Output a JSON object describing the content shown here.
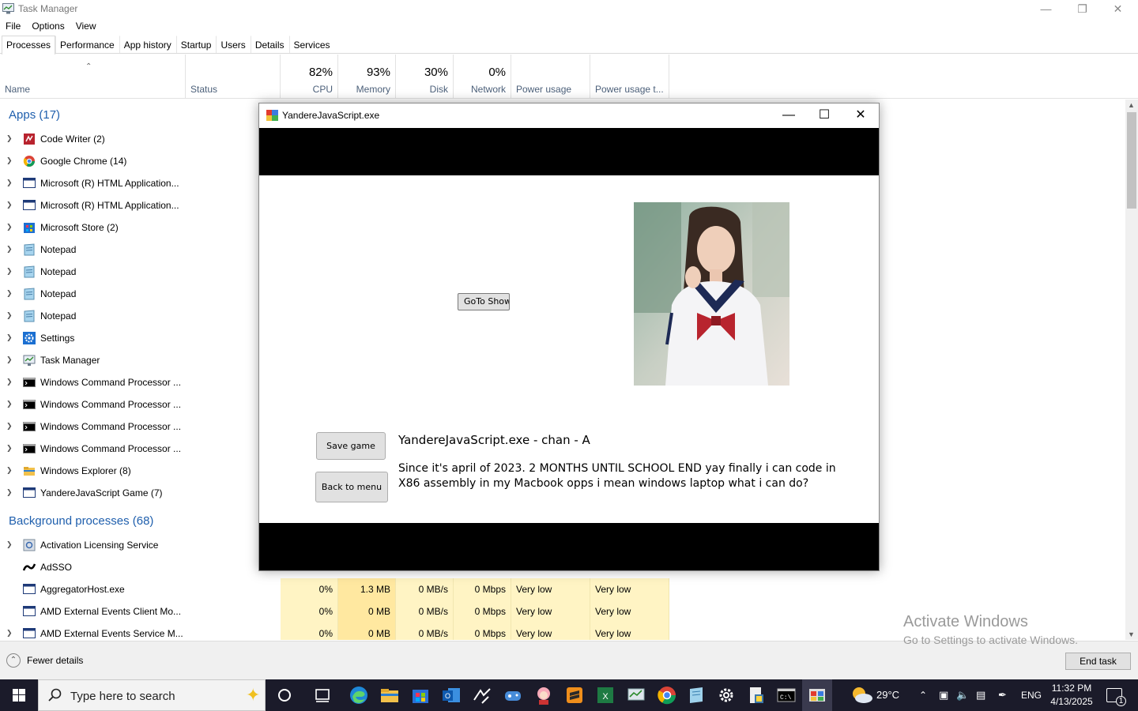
{
  "taskmanager": {
    "title": "Task Manager",
    "menu": [
      "File",
      "Options",
      "View"
    ],
    "tabs": [
      "Processes",
      "Performance",
      "App history",
      "Startup",
      "Users",
      "Details",
      "Services"
    ],
    "active_tab": "Processes",
    "columns": {
      "name": "Name",
      "status": "Status",
      "cpu": {
        "pct": "82%",
        "label": "CPU"
      },
      "memory": {
        "pct": "93%",
        "label": "Memory"
      },
      "disk": {
        "pct": "30%",
        "label": "Disk"
      },
      "network": {
        "pct": "0%",
        "label": "Network"
      },
      "power": "Power usage",
      "power_trend": "Power usage t..."
    },
    "apps_header": "Apps (17)",
    "apps": [
      {
        "name": "Code Writer (2)",
        "icon": "code-writer-icon"
      },
      {
        "name": "Google Chrome (14)",
        "icon": "chrome-icon"
      },
      {
        "name": "Microsoft (R) HTML Application...",
        "icon": "window-icon"
      },
      {
        "name": "Microsoft (R) HTML Application...",
        "icon": "window-icon"
      },
      {
        "name": "Microsoft Store (2)",
        "icon": "store-icon"
      },
      {
        "name": "Notepad",
        "icon": "notepad-icon"
      },
      {
        "name": "Notepad",
        "icon": "notepad-icon"
      },
      {
        "name": "Notepad",
        "icon": "notepad-icon"
      },
      {
        "name": "Notepad",
        "icon": "notepad-icon"
      },
      {
        "name": "Settings",
        "icon": "gear-icon"
      },
      {
        "name": "Task Manager",
        "icon": "task-manager-icon"
      },
      {
        "name": "Windows Command Processor ...",
        "icon": "cmd-icon"
      },
      {
        "name": "Windows Command Processor ...",
        "icon": "cmd-icon"
      },
      {
        "name": "Windows Command Processor ...",
        "icon": "cmd-icon"
      },
      {
        "name": "Windows Command Processor ...",
        "icon": "cmd-icon"
      },
      {
        "name": "Windows Explorer (8)",
        "icon": "folder-icon"
      },
      {
        "name": "YandereJavaScript Game (7)",
        "icon": "window-icon"
      }
    ],
    "bg_header": "Background processes (68)",
    "bg": [
      {
        "name": "Activation Licensing Service",
        "expand": true,
        "icon": "service-icon",
        "values": null
      },
      {
        "name": "AdSSO",
        "expand": false,
        "icon": "adsso-icon",
        "values": null
      },
      {
        "name": "AggregatorHost.exe",
        "expand": false,
        "icon": "window-icon",
        "values": {
          "cpu": "0%",
          "mem": "1.3 MB",
          "disk": "0 MB/s",
          "net": "0 Mbps",
          "power": "Very low",
          "trend": "Very low"
        }
      },
      {
        "name": "AMD External Events Client Mo...",
        "expand": false,
        "icon": "window-icon",
        "values": {
          "cpu": "0%",
          "mem": "0 MB",
          "disk": "0 MB/s",
          "net": "0 Mbps",
          "power": "Very low",
          "trend": "Very low"
        }
      },
      {
        "name": "AMD External Events Service M...",
        "expand": true,
        "icon": "window-icon",
        "values": {
          "cpu": "0%",
          "mem": "0 MB",
          "disk": "0 MB/s",
          "net": "0 Mbps",
          "power": "Very low",
          "trend": "Very low"
        }
      }
    ],
    "fewer_details": "Fewer details",
    "end_task": "End task",
    "watermark_line1": "Activate Windows",
    "watermark_line2": "Go to Settings to activate Windows."
  },
  "game": {
    "title": "YandereJavaScript.exe",
    "goto_show": "GoTo Show",
    "save_game": "Save game",
    "back_to_menu": "Back to menu",
    "speaker": "YandereJavaScript.exe - chan - A",
    "dialog": "Since it's april of 2023. 2 MONTHS UNTIL SCHOOL END yay finally i can code in X86 assembly in my Macbook opps i mean windows laptop what i can do?"
  },
  "taskbar": {
    "search_placeholder": "Type here to search",
    "weather": "29°C",
    "language": "ENG",
    "time": "11:32 PM",
    "date": "4/13/2025",
    "notifications": "1"
  }
}
